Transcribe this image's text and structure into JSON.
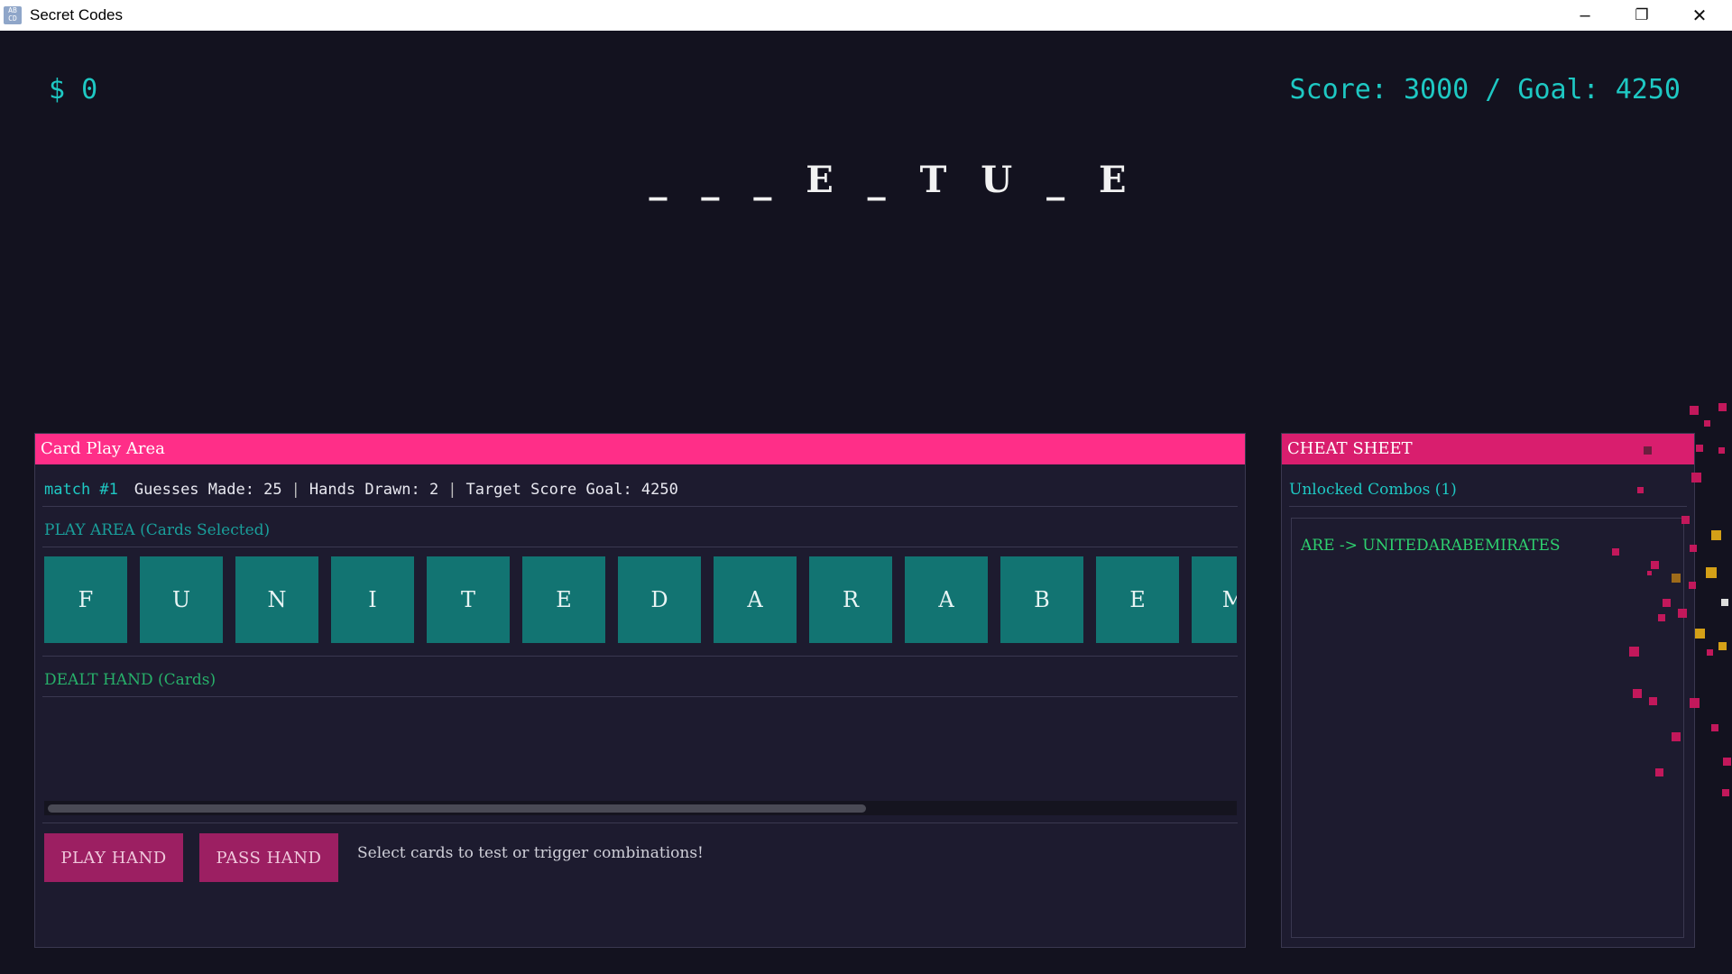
{
  "window": {
    "title": "Secret Codes",
    "icon_text": "AB CD",
    "minimize": "–",
    "restore": "❐",
    "close": "✕"
  },
  "hud": {
    "money": "$ 0",
    "score": "Score: 3000 / Goal: 4250"
  },
  "puzzle": "_ _ _ E _ T U _ E",
  "card_area": {
    "header": "Card Play Area",
    "match": "match #1",
    "guesses": "Guesses Made: 25",
    "hands": "Hands Drawn: 2",
    "target": "Target Score Goal: 4250",
    "separator": "|",
    "play_area_label": "PLAY AREA (Cards Selected)",
    "cards": [
      "F",
      "U",
      "N",
      "I",
      "T",
      "E",
      "D",
      "A",
      "R",
      "A",
      "B",
      "E",
      "M"
    ],
    "dealt_label": "DEALT HAND (Cards)",
    "scroll_fraction": 0.69,
    "play_button": "PLAY HAND",
    "pass_button": "PASS HAND",
    "hint": "Select cards to test or trigger combinations!"
  },
  "cheat_sheet": {
    "header": "CHEAT SHEET",
    "subtitle": "Unlocked Combos (1)",
    "combos": [
      "ARE -> UNITEDARABEMIRATES"
    ]
  },
  "colors": {
    "accent_teal": "#1ec8c3",
    "header_pink": "#ff2e88",
    "card_teal": "#127472",
    "button_magenta": "#9c1f62",
    "combo_green": "#2ed06f"
  }
}
